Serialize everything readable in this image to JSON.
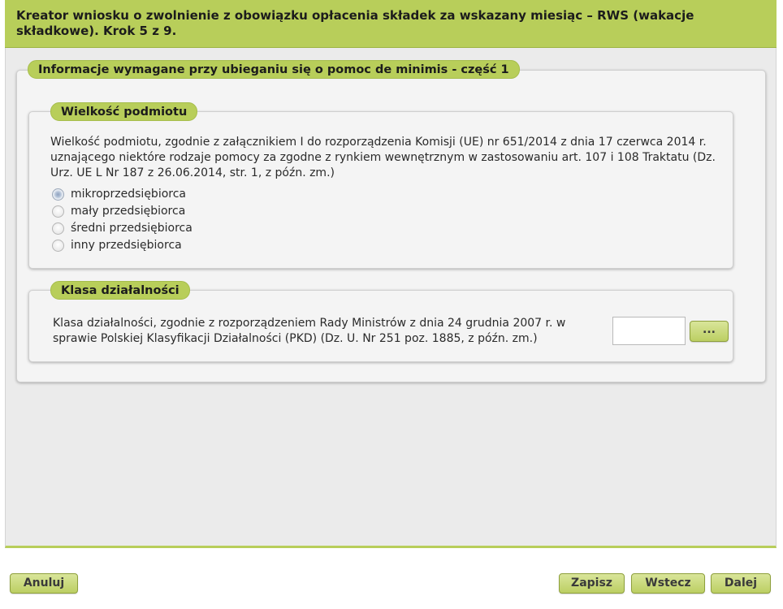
{
  "header": {
    "title": "Kreator wniosku o zwolnienie z obowiązku opłacenia składek za wskazany miesiąc – RWS (wakacje składkowe). Krok 5 z 9."
  },
  "section": {
    "title": "Informacje wymagane przy ubieganiu się o pomoc de minimis - część 1"
  },
  "size_section": {
    "title": "Wielkość podmiotu",
    "description": "Wielkość podmiotu, zgodnie z załącznikiem I do rozporządzenia Komisji (UE) nr 651/2014 z dnia 17 czerwca 2014 r. uznającego niektóre rodzaje pomocy za zgodne z rynkiem wewnętrznym w zastosowaniu art. 107 i 108 Traktatu (Dz. Urz. UE L Nr 187 z 26.06.2014, str. 1, z późn. zm.)",
    "options": [
      {
        "label": "mikroprzedsiębiorca",
        "selected": true
      },
      {
        "label": "mały przedsiębiorca",
        "selected": false
      },
      {
        "label": "średni przedsiębiorca",
        "selected": false
      },
      {
        "label": "inny przedsiębiorca",
        "selected": false
      }
    ]
  },
  "activity_section": {
    "title": "Klasa działalności",
    "description": "Klasa działalności, zgodnie z rozporządzeniem Rady Ministrów z dnia 24 grudnia 2007 r. w sprawie Polskiej Klasyfikacji Działalności (PKD) (Dz. U. Nr 251 poz. 1885, z późn. zm.)",
    "pkd_value": "",
    "browse_label": "..."
  },
  "footer": {
    "cancel_label": "Anuluj",
    "save_label": "Zapisz",
    "back_label": "Wstecz",
    "next_label": "Dalej"
  },
  "colors": {
    "accent": "#b8ce5a",
    "panel_bg": "#f4f4f4",
    "content_bg": "#ebebeb"
  }
}
